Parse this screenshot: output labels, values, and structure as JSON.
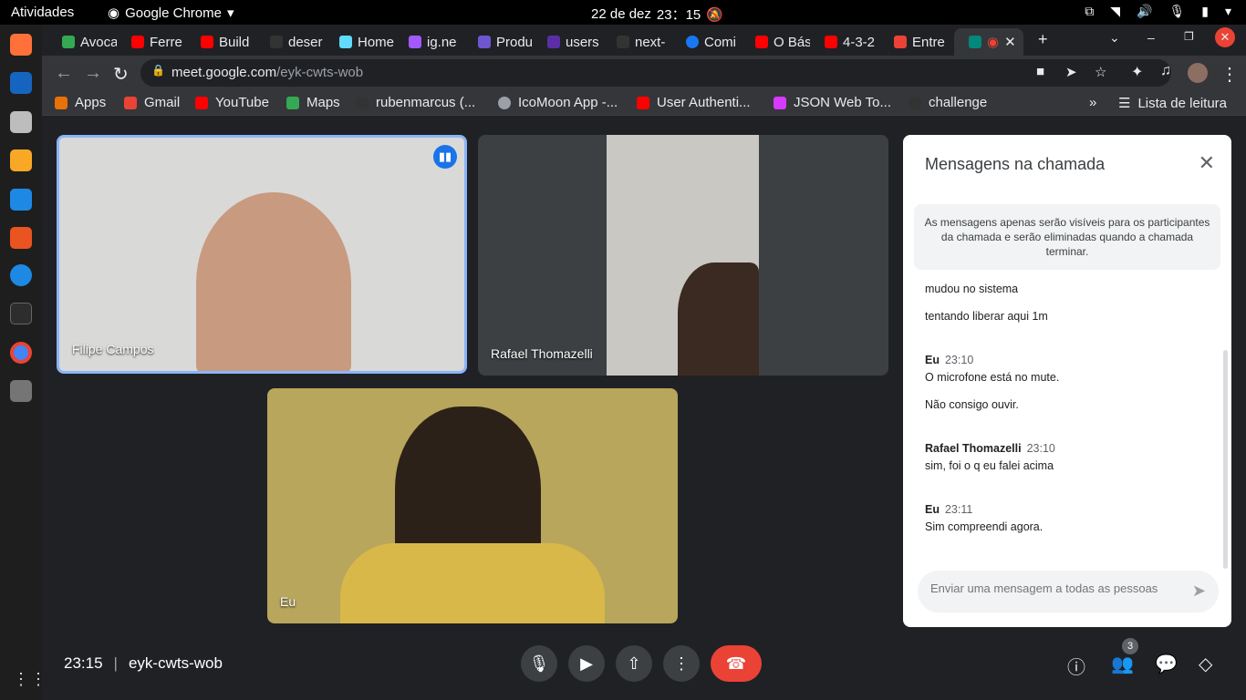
{
  "system": {
    "activities": "Atividades",
    "app_name": "Google Chrome",
    "date": "22 de dez",
    "time": "23：15"
  },
  "tabs": [
    {
      "label": "Avoca",
      "color": "#34a853"
    },
    {
      "label": "Ferre",
      "color": "#ff0000"
    },
    {
      "label": "Build",
      "color": "#ff0000"
    },
    {
      "label": "deser",
      "color": "#333333"
    },
    {
      "label": "Home",
      "color": "#61dafb"
    },
    {
      "label": "ig.ne",
      "color": "#a259ff"
    },
    {
      "label": "Produ",
      "color": "#6e56cf"
    },
    {
      "label": "users",
      "color": "#5a2ea6"
    },
    {
      "label": "next-",
      "color": "#333333"
    },
    {
      "label": "Comi",
      "color": "#1877f2"
    },
    {
      "label": "O Bás",
      "color": "#ff0000"
    },
    {
      "label": "4-3-2",
      "color": "#ff0000"
    },
    {
      "label": "Entre",
      "color": "#ea4335"
    },
    {
      "label": "",
      "color": "#00897b"
    }
  ],
  "address": {
    "host": "meet.google.com",
    "path": "/eyk-cwts-wob"
  },
  "bookmarks": [
    {
      "label": "Apps",
      "color": "#e8710a"
    },
    {
      "label": "Gmail",
      "color": "#ea4335"
    },
    {
      "label": "YouTube",
      "color": "#ff0000"
    },
    {
      "label": "Maps",
      "color": "#34a853"
    },
    {
      "label": "rubenmarcus (...",
      "color": "#333333"
    },
    {
      "label": "IcoMoon App -...",
      "color": "#9aa0a6"
    },
    {
      "label": "User Authenti...",
      "color": "#ff0000"
    },
    {
      "label": "JSON Web To...",
      "color": "#d63aff"
    },
    {
      "label": "challenge",
      "color": "#333333"
    }
  ],
  "reading_list": "Lista de leitura",
  "participants": {
    "p1": "Filipe Campos",
    "p2": "Rafael Thomazelli",
    "me": "Eu"
  },
  "chat": {
    "title": "Mensagens na chamada",
    "notice": "As mensagens apenas serão visíveis para os participantes da chamada e serão eliminadas quando a chamada terminar.",
    "messages": [
      {
        "sender": "",
        "time": "",
        "text": "mudou no sistema"
      },
      {
        "sender": "",
        "time": "",
        "text": "tentando liberar aqui 1m"
      },
      {
        "sender": "Eu",
        "time": "23:10",
        "text": "O microfone está no mute."
      },
      {
        "sender": "",
        "time": "",
        "text": "Não consigo ouvir."
      },
      {
        "sender": "Rafael Thomazelli",
        "time": "23:10",
        "text": "sim, foi o q eu falei acima"
      },
      {
        "sender": "Eu",
        "time": "23:11",
        "text": "Sim compreendi agora."
      }
    ],
    "input_placeholder": "Enviar uma mensagem a todas as pessoas"
  },
  "meeting": {
    "time": "23:15",
    "code": "eyk-cwts-wob",
    "participant_count": "3"
  }
}
